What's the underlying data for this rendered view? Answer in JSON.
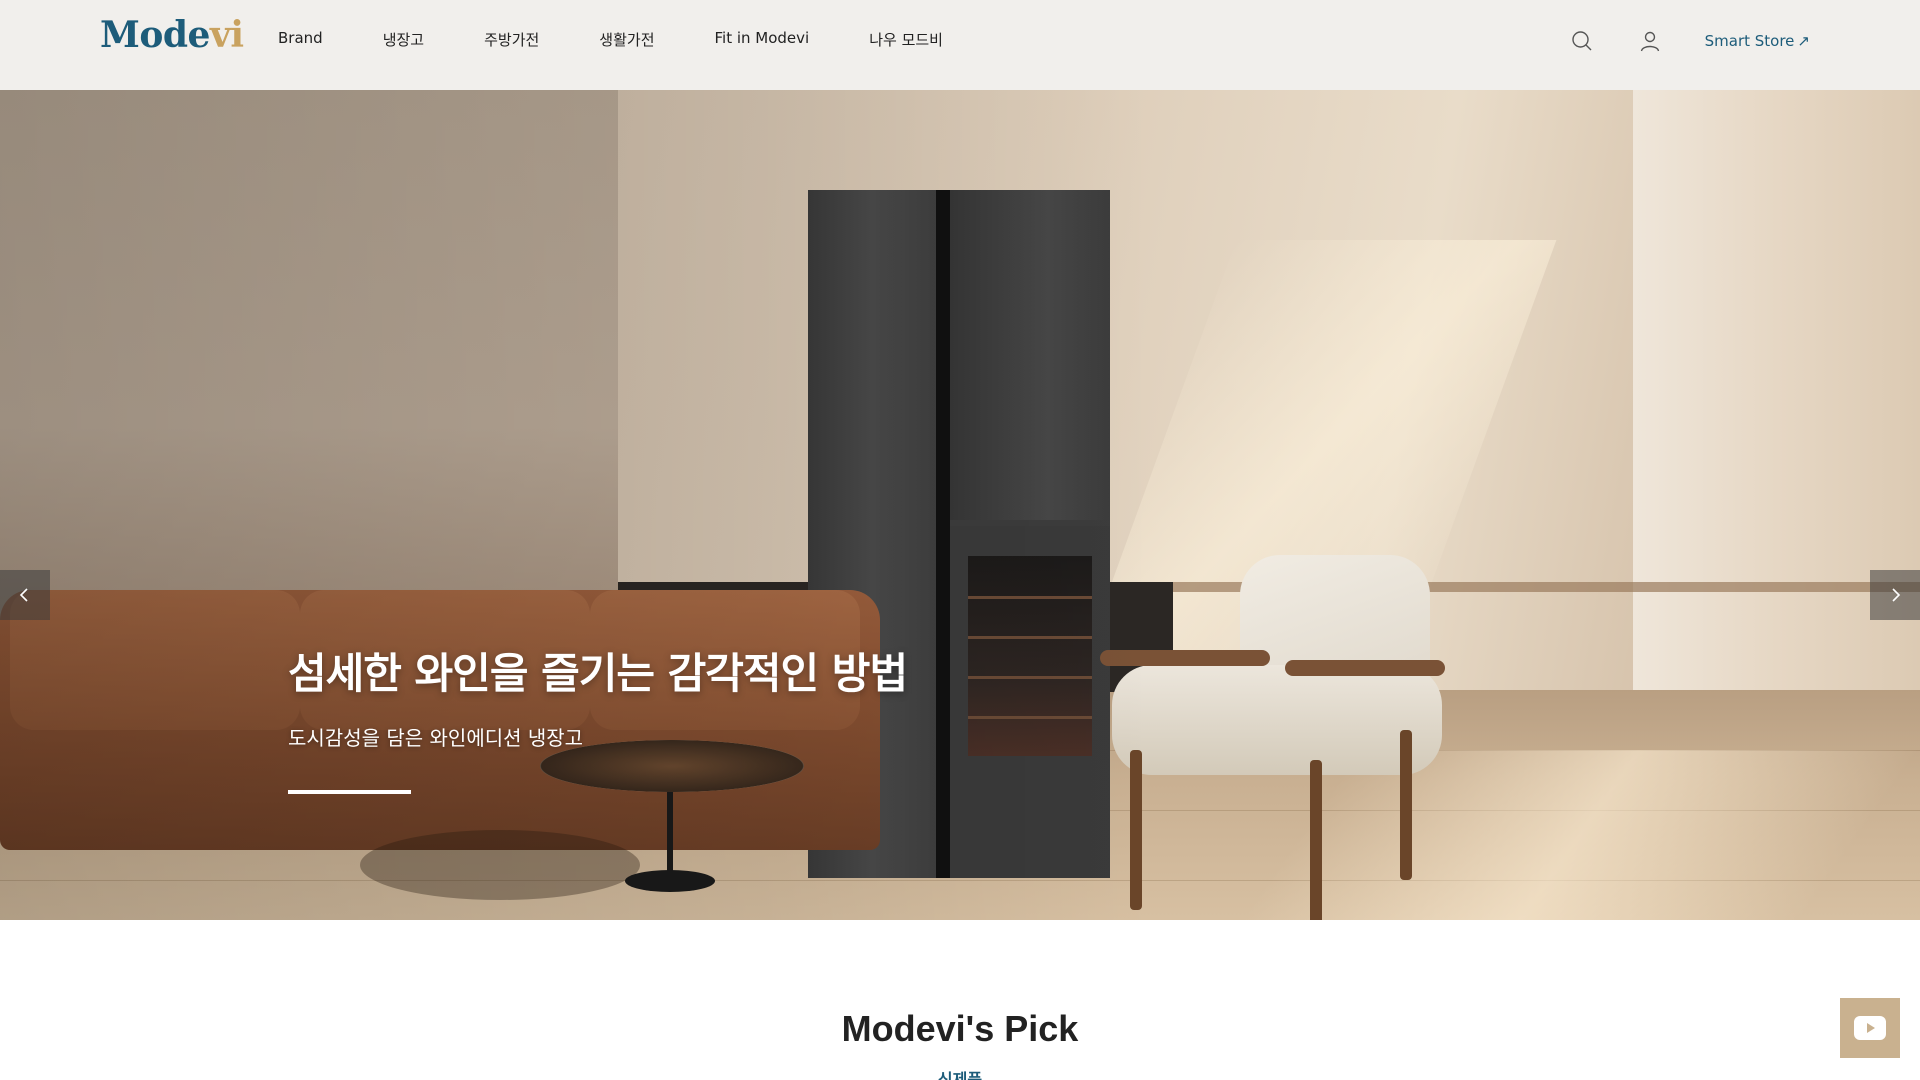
{
  "header": {
    "logo": {
      "main": "Mode",
      "accent": "vi"
    },
    "nav": [
      {
        "label": "Brand"
      },
      {
        "label": "냉장고"
      },
      {
        "label": "주방가전"
      },
      {
        "label": "생활가전"
      },
      {
        "label": "Fit in Modevi"
      },
      {
        "label": "나우 모드비"
      }
    ],
    "icons": {
      "search": "search-icon",
      "account": "user-icon"
    },
    "smart_store": {
      "label": "Smart Store",
      "arrow": "↗"
    }
  },
  "hero": {
    "title": "섬세한 와인을 즐기는 감각적인 방법",
    "subtitle": "도시감성을 담은 와인에디션 냉장고",
    "progress": 0.41,
    "prev_icon": "chevron-left-icon",
    "next_icon": "chevron-right-icon"
  },
  "section": {
    "title": "Modevi's Pick",
    "tab": "신제품"
  },
  "floating": {
    "youtube_icon": "youtube-icon"
  },
  "colors": {
    "brand": "#1d5c7a",
    "logo_accent": "#c9a25f",
    "header_bg": "#f1efec",
    "youtube_bg": "#c9b18f"
  }
}
